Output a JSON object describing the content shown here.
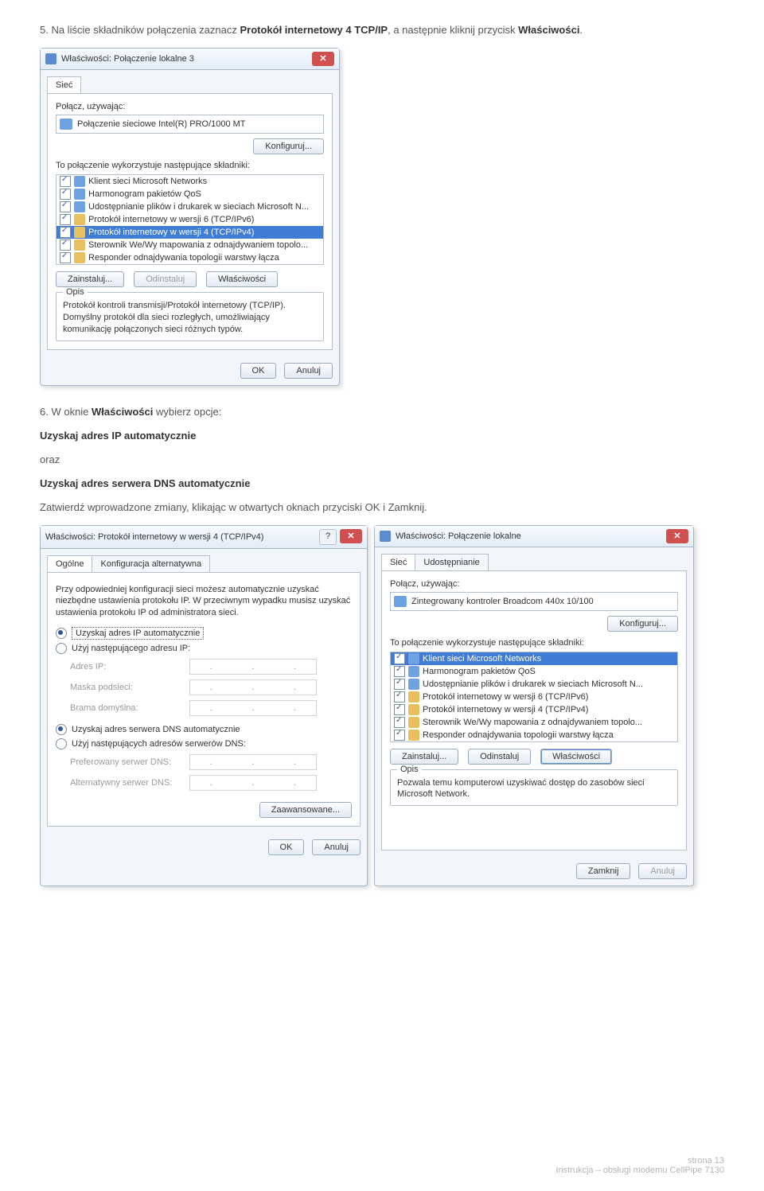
{
  "instr1": {
    "prefix": "5. Na liście składników połączenia zaznacz ",
    "bold1": "Protokół internetowy 4 TCP/IP",
    "mid": ", a następnie kliknij przycisk ",
    "bold2": "Właściwości",
    "suffix": "."
  },
  "dlg1": {
    "title": "Właściwości: Połączenie lokalne 3",
    "tab_siec": "Sieć",
    "connect_using": "Połącz, używając:",
    "adapter": "Połączenie sieciowe Intel(R) PRO/1000 MT",
    "konfiguruj": "Konfiguruj...",
    "uses_components": "To połączenie wykorzystuje następujące składniki:",
    "items": [
      "Klient sieci Microsoft Networks",
      "Harmonogram pakietów QoS",
      "Udostępnianie plików i drukarek w sieciach Microsoft N...",
      "Protokół internetowy w wersji 6 (TCP/IPv6)",
      "Protokół internetowy w wersji 4 (TCP/IPv4)",
      "Sterownik We/Wy mapowania z odnajdywaniem topolo...",
      "Responder odnajdywania topologii warstwy łącza"
    ],
    "zainstaluj": "Zainstaluj...",
    "odinstaluj": "Odinstaluj",
    "wlasciwosci": "Właściwości",
    "opis_label": "Opis",
    "opis": "Protokół kontroli transmisji/Protokół internetowy (TCP/IP). Domyślny protokół dla sieci rozległych, umożliwiający komunikację połączonych sieci różnych typów.",
    "ok": "OK",
    "anuluj": "Anuluj"
  },
  "instr2": {
    "line1": {
      "prefix": "6. W oknie ",
      "bold": "Właściwości",
      "suffix": " wybierz opcje:"
    },
    "line2": "Uzyskaj adres IP automatycznie",
    "line3": "oraz",
    "line4": "Uzyskaj adres serwera DNS automatycznie",
    "line5": "Zatwierdź wprowadzone zmiany, klikając w otwartych oknach przyciski OK i Zamknij."
  },
  "dlg2": {
    "title": "Właściwości: Protokół internetowy w wersji 4 (TCP/IPv4)",
    "tab_ogolne": "Ogólne",
    "tab_konfig": "Konfiguracja alternatywna",
    "intro": "Przy odpowiedniej konfiguracji sieci możesz automatycznie uzyskać niezbędne ustawienia protokołu IP. W przeciwnym wypadku musisz uzyskać ustawienia protokołu IP od administratora sieci.",
    "r1": "Uzyskaj adres IP automatycznie",
    "r2": "Użyj następującego adresu IP:",
    "lbl_ip": "Adres IP:",
    "lbl_mask": "Maska podsieci:",
    "lbl_gw": "Brama domyślna:",
    "r3": "Uzyskaj adres serwera DNS automatycznie",
    "r4": "Użyj następujących adresów serwerów DNS:",
    "lbl_pdns": "Preferowany serwer DNS:",
    "lbl_adns": "Alternatywny serwer DNS:",
    "zaaw": "Zaawansowane...",
    "ok": "OK",
    "anuluj": "Anuluj"
  },
  "dlg3": {
    "title": "Właściwości: Połączenie lokalne",
    "tab_siec": "Sieć",
    "tab_udost": "Udostępnianie",
    "connect_using": "Połącz, używając:",
    "adapter": "Zintegrowany kontroler Broadcom 440x 10/100",
    "konfiguruj": "Konfiguruj...",
    "uses_components": "To połączenie wykorzystuje następujące składniki:",
    "items": [
      "Klient sieci Microsoft Networks",
      "Harmonogram pakietów QoS",
      "Udostępnianie plików i drukarek w sieciach Microsoft N...",
      "Protokół internetowy w wersji 6 (TCP/IPv6)",
      "Protokół internetowy w wersji 4 (TCP/IPv4)",
      "Sterownik We/Wy mapowania z odnajdywaniem topolo...",
      "Responder odnajdywania topologii warstwy łącza"
    ],
    "zainstaluj": "Zainstaluj...",
    "odinstaluj": "Odinstaluj",
    "wlasciwosci": "Właściwości",
    "opis_label": "Opis",
    "opis": "Pozwala temu komputerowi uzyskiwać dostęp do zasobów sieci Microsoft Network.",
    "zamknij": "Zamknij",
    "anuluj": "Anuluj"
  },
  "footer": {
    "page": "strona 13",
    "doc": "Instrukcja – obsługi modemu CellPipe 7130"
  }
}
